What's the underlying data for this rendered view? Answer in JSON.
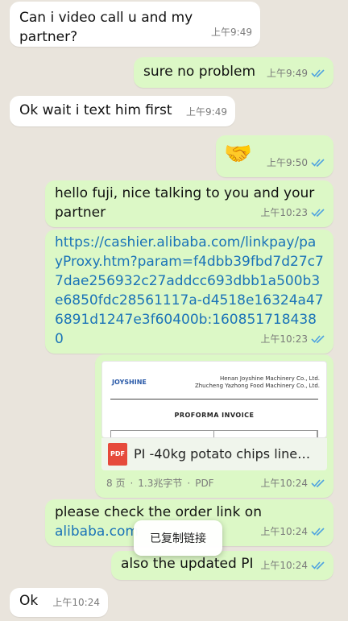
{
  "colors": {
    "incoming": "#ffffff",
    "outgoing": "#dcf8c6",
    "link": "#1a73b8",
    "tick": "#4fa3e0",
    "pdf": "#e64a3b"
  },
  "messages": [
    {
      "dir": "in",
      "text": "Can i video call u and my partner?",
      "time": "上午9:49"
    },
    {
      "dir": "out",
      "text": "sure no problem",
      "time": "上午9:49",
      "read": true
    },
    {
      "dir": "in",
      "text": "Ok wait i text him first",
      "time": "上午9:49"
    },
    {
      "dir": "out",
      "text": "🤝",
      "time": "上午9:50",
      "read": true
    },
    {
      "dir": "out",
      "text": "hello fuji, nice talking to you and your partner",
      "time": "上午10:23",
      "read": true
    },
    {
      "dir": "out",
      "text": "https://cashier.alibaba.com/linkpay/payProxy.htm?param=f4dbb39fbd7d27c77dae256932c27addcc693dbb1a500b3e6850fdc28561117a-d4518e16324a476891d1247e3f60400b:1608517184380",
      "time": "上午10:23",
      "read": true
    },
    {
      "dir": "out",
      "file": {
        "name": "PI -40kg potato chips line…",
        "pages": "8 页",
        "size": "1.3兆字节",
        "type": "PDF",
        "icon_label": "PDF",
        "preview_company": "Henan Joyshine Machinery Co., Ltd.",
        "preview_company2": "Zhucheng Yazhong Food Machinery Co., Ltd.",
        "preview_title": "PROFORMA INVOICE",
        "preview_logo": "JOYSHINE"
      },
      "time": "上午10:24",
      "read": true
    },
    {
      "dir": "out",
      "text": "please check the order link on alibaba.com",
      "link_part": "alibaba.com",
      "time": "上午10:24",
      "read": true
    },
    {
      "dir": "out",
      "text": "also the updated PI",
      "time": "上午10:24",
      "read": true
    },
    {
      "dir": "in",
      "text": "Ok",
      "time": "上午10:24"
    }
  ],
  "toast": "已复制链接"
}
